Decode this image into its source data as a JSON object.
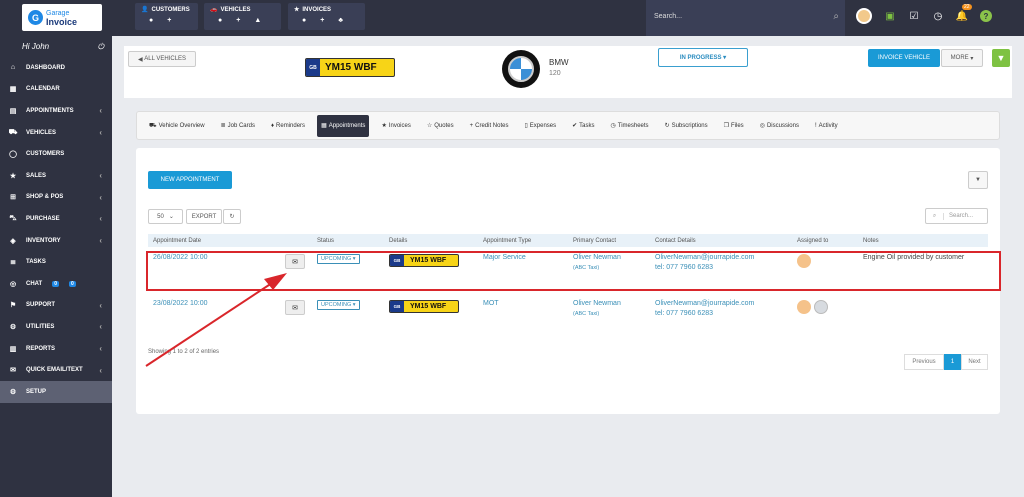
{
  "brand": {
    "logo_small": "Garage",
    "logo_big": "Invoice"
  },
  "quick": [
    {
      "title": "CUSTOMERS"
    },
    {
      "title": "VEHICLES"
    },
    {
      "title": "INVOICES"
    }
  ],
  "search": {
    "placeholder": "Search..."
  },
  "notifications": {
    "count": "22"
  },
  "sidebar": {
    "greeting": "Hi John",
    "items": [
      {
        "label": "DASHBOARD",
        "icon": "home-icon"
      },
      {
        "label": "CALENDAR",
        "icon": "calendar-icon"
      },
      {
        "label": "APPOINTMENTS",
        "icon": "appointments-icon"
      },
      {
        "label": "VEHICLES",
        "icon": "car-icon"
      },
      {
        "label": "CUSTOMERS",
        "icon": "user-icon"
      },
      {
        "label": "SALES",
        "icon": "star-icon"
      },
      {
        "label": "SHOP & POS",
        "icon": "shop-icon"
      },
      {
        "label": "PURCHASE",
        "icon": "cart-icon"
      },
      {
        "label": "INVENTORY",
        "icon": "box-icon"
      },
      {
        "label": "TASKS",
        "icon": "tasks-icon"
      },
      {
        "label": "CHAT",
        "icon": "chat-icon",
        "badges": [
          "0",
          "0"
        ]
      },
      {
        "label": "SUPPORT",
        "icon": "support-icon"
      },
      {
        "label": "UTILITIES",
        "icon": "utilities-icon"
      },
      {
        "label": "REPORTS",
        "icon": "reports-icon"
      },
      {
        "label": "QUICK EMAIL/TEXT",
        "icon": "email-icon"
      },
      {
        "label": "SETUP",
        "icon": "gear-icon"
      }
    ]
  },
  "vehicle": {
    "back_label": "ALL VEHICLES",
    "plate_country": "GB",
    "plate": "YM15 WBF",
    "make": "BMW",
    "model": "120",
    "status": "IN PROGRESS",
    "invoice_label": "INVOICE VEHICLE",
    "more_label": "MORE"
  },
  "tabs": [
    {
      "label": "Vehicle Overview",
      "icon": "car-icon"
    },
    {
      "label": "Job Cards",
      "icon": "list-icon"
    },
    {
      "label": "Reminders",
      "icon": "bell-icon"
    },
    {
      "label": "Appointments",
      "icon": "calendar-icon",
      "active": true
    },
    {
      "label": "Invoices",
      "icon": "star-icon"
    },
    {
      "label": "Quotes",
      "icon": "star-outline-icon"
    },
    {
      "label": "Credit Notes",
      "icon": "plus-icon"
    },
    {
      "label": "Expenses",
      "icon": "file-icon"
    },
    {
      "label": "Tasks",
      "icon": "check-icon"
    },
    {
      "label": "Timesheets",
      "icon": "clock-icon"
    },
    {
      "label": "Subscriptions",
      "icon": "refresh-icon"
    },
    {
      "label": "Files",
      "icon": "files-icon"
    },
    {
      "label": "Discussions",
      "icon": "chat-icon"
    },
    {
      "label": "Activity",
      "icon": "exclamation-icon"
    }
  ],
  "appointments": {
    "new_label": "NEW APPOINTMENT",
    "page_size": "50",
    "export_label": "EXPORT",
    "search_placeholder": "Search...",
    "columns": [
      "Appointment Date",
      "",
      "Status",
      "Details",
      "Appointment Type",
      "Primary Contact",
      "Contact Details",
      "Assigned to",
      "Notes"
    ],
    "rows": [
      {
        "date": "26/08/2022 10:00",
        "status": "UPCOMING",
        "plate_country": "GB",
        "plate": "YM15 WBF",
        "type": "Major Service",
        "contact": "Oliver Newman",
        "company": "(ABC Taxi)",
        "email": "OliverNewman@jourrapide.com",
        "tel": "tel: 077 7960 6283",
        "notes": "Engine Oil provided by customer"
      },
      {
        "date": "23/08/2022 10:00",
        "status": "UPCOMING",
        "plate_country": "GB",
        "plate": "YM15 WBF",
        "type": "MOT",
        "contact": "Oliver Newman",
        "company": "(ABC Taxi)",
        "email": "OliverNewman@jourrapide.com",
        "tel": "tel: 077 7960 6283",
        "notes": ""
      }
    ],
    "footer": "Showing 1 to 2 of 2 entries",
    "pager": {
      "prev": "Previous",
      "page": "1",
      "next": "Next"
    }
  },
  "annotation": {
    "box_color": "#d9262b",
    "arrow_color": "#d9262b"
  }
}
